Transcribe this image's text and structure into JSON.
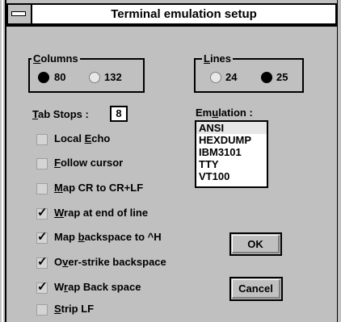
{
  "window": {
    "title": "Terminal emulation setup"
  },
  "columns": {
    "label_prefix": "",
    "label_key": "C",
    "label_rest": "olumns",
    "options": [
      {
        "label": "80",
        "selected": true
      },
      {
        "label": "132",
        "selected": false
      }
    ]
  },
  "lines": {
    "label_key": "L",
    "label_rest": "ines",
    "options": [
      {
        "label": "24",
        "selected": false
      },
      {
        "label": "25",
        "selected": true
      }
    ]
  },
  "tab_stops": {
    "label_key": "T",
    "label_rest": "ab Stops :",
    "value": "8"
  },
  "emulation": {
    "label_pre": "Em",
    "label_key": "u",
    "label_rest": "lation :",
    "items": [
      "ANSI",
      "HEXDUMP",
      "IBM3101",
      "TTY",
      "VT100"
    ],
    "selected": "ANSI"
  },
  "checkboxes": [
    {
      "pre": "Local ",
      "key": "E",
      "rest": "cho",
      "checked": false
    },
    {
      "pre": "",
      "key": "F",
      "rest": "ollow cursor",
      "checked": false
    },
    {
      "pre": "",
      "key": "M",
      "rest": "ap CR to CR+LF",
      "checked": false
    },
    {
      "pre": "",
      "key": "W",
      "rest": "rap at end of line",
      "checked": true
    },
    {
      "pre": "Map ",
      "key": "b",
      "rest": "ackspace to ^H",
      "checked": true
    },
    {
      "pre": "O",
      "key": "v",
      "rest": "er-strike backspace",
      "checked": true
    },
    {
      "pre": "W",
      "key": "r",
      "rest": "ap Back space",
      "checked": true
    },
    {
      "pre": "",
      "key": "S",
      "rest": "trip LF",
      "checked": false
    }
  ],
  "buttons": {
    "ok": "OK",
    "cancel": "Cancel"
  },
  "colors": {
    "face": "#c0c0c0",
    "text": "#000000",
    "window": "#ffffff"
  }
}
